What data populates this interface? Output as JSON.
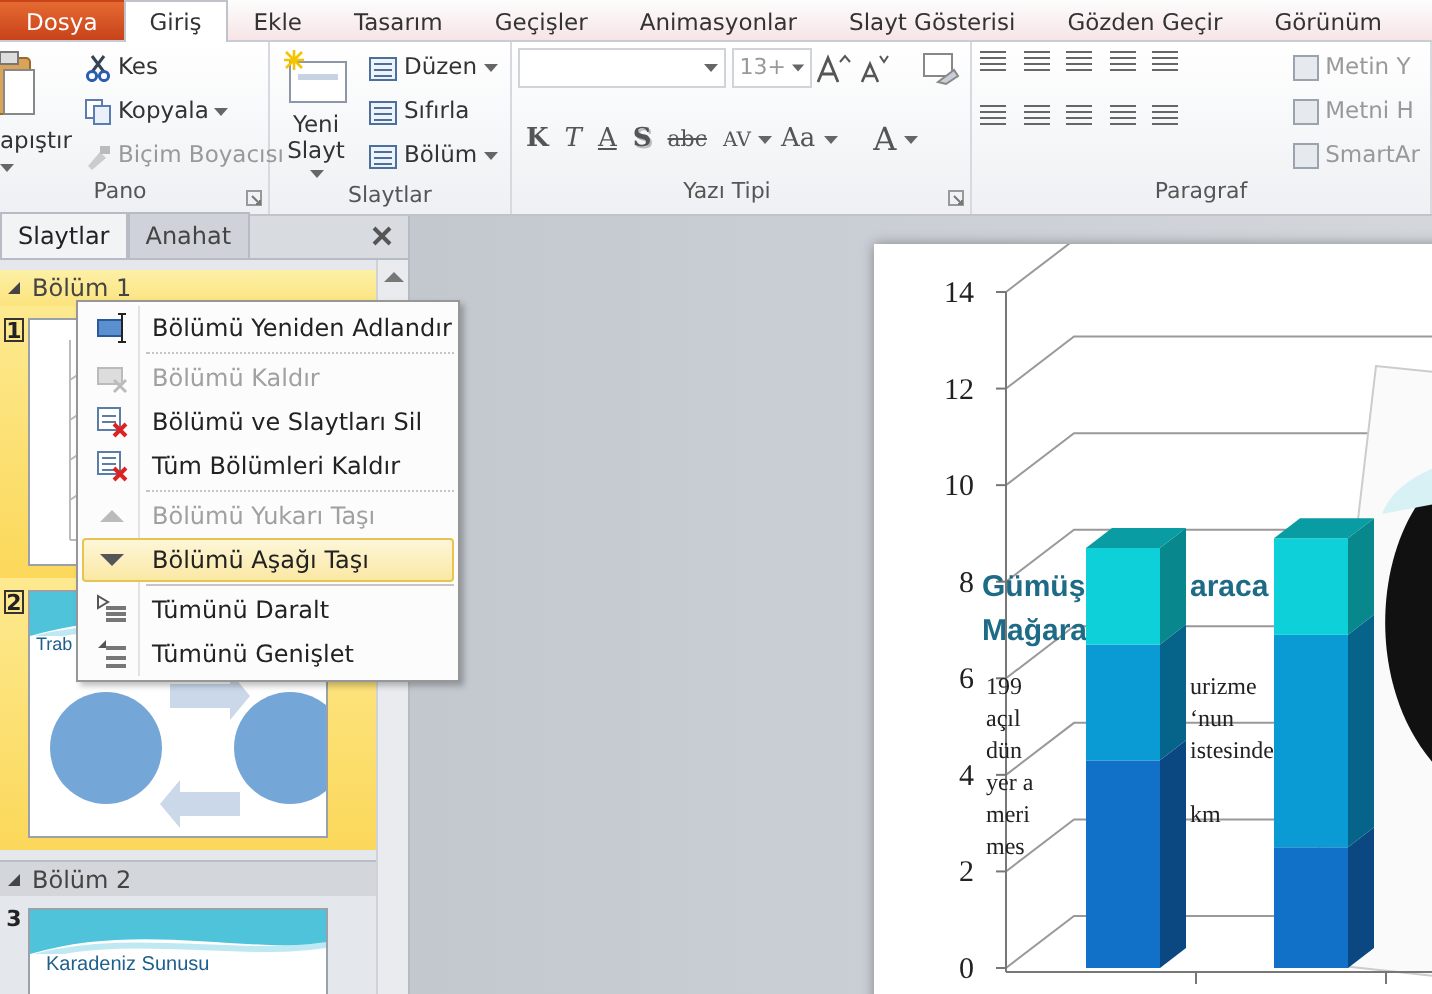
{
  "ribbon_tabs": [
    {
      "label": "Dosya",
      "kind": "file",
      "selected": false
    },
    {
      "label": "Giriş",
      "kind": "tab",
      "selected": true
    },
    {
      "label": "Ekle",
      "kind": "tab",
      "selected": false
    },
    {
      "label": "Tasarım",
      "kind": "tab",
      "selected": false
    },
    {
      "label": "Geçişler",
      "kind": "tab",
      "selected": false
    },
    {
      "label": "Animasyonlar",
      "kind": "tab",
      "selected": false
    },
    {
      "label": "Slayt Gösterisi",
      "kind": "tab",
      "selected": false
    },
    {
      "label": "Gözden Geçir",
      "kind": "tab",
      "selected": false
    },
    {
      "label": "Görünüm",
      "kind": "tab",
      "selected": false
    }
  ],
  "clipboard_group": {
    "title": "Pano",
    "paste": "apıştır",
    "cut": "Kes",
    "copy": "Kopyala",
    "format_painter": {
      "label": "Biçim Boyacısı",
      "disabled": true
    }
  },
  "slides_group": {
    "title": "Slaytlar",
    "new_slide": "Yeni Slayt",
    "layout": "Düzen",
    "reset": "Sıfırla",
    "section": "Bölüm"
  },
  "font_group": {
    "title": "Yazı Tipi",
    "font_size": "13+",
    "format_buttons": [
      "K",
      "T",
      "A",
      "S",
      "abc",
      "AV",
      "Aa",
      "A"
    ]
  },
  "paragraph_group": {
    "title": "Paragraf",
    "text_commands": [
      "Metin Y",
      "Metni H",
      "SmartAr"
    ]
  },
  "pane": {
    "tabs": [
      {
        "label": "Slaytlar",
        "selected": true
      },
      {
        "label": "Anahat",
        "selected": false
      }
    ],
    "sections": [
      {
        "title": "Bölüm 1",
        "selected": true,
        "slides": [
          {
            "number": "1"
          },
          {
            "number": "2",
            "title": "Trab"
          }
        ]
      },
      {
        "title": "Bölüm 2",
        "selected": false,
        "slides": [
          {
            "number": "3",
            "title": "Karadeniz Sunusu"
          }
        ]
      }
    ]
  },
  "context_menu": [
    {
      "kind": "item",
      "label": "Bölümü Yeniden Adlandır",
      "disabled": false,
      "selected": false
    },
    {
      "kind": "separator"
    },
    {
      "kind": "item",
      "label": "Bölümü Kaldır",
      "disabled": true,
      "selected": false
    },
    {
      "kind": "item",
      "label": "Bölümü ve Slaytları Sil",
      "disabled": false,
      "selected": false
    },
    {
      "kind": "item",
      "label": "Tüm Bölümleri Kaldır",
      "disabled": false,
      "selected": false
    },
    {
      "kind": "separator"
    },
    {
      "kind": "item",
      "label": "Bölümü Yukarı Taşı",
      "disabled": true,
      "selected": false
    },
    {
      "kind": "item",
      "label": "Bölümü Aşağı Taşı",
      "disabled": false,
      "selected": true
    },
    {
      "kind": "separator"
    },
    {
      "kind": "item",
      "label": "Tümünü Daralt",
      "disabled": false,
      "selected": false
    },
    {
      "kind": "item",
      "label": "Tümünü Genişlet",
      "disabled": false,
      "selected": false
    }
  ],
  "slide": {
    "title_fragments": [
      "Gümüş",
      "araca",
      "Mağara"
    ],
    "body_fragments": [
      "199",
      "urizme",
      "açıl",
      "‘nun",
      "dün",
      "istesinde",
      "yer a",
      "meri",
      "km",
      "mes"
    ],
    "chart_data": {
      "type": "bar",
      "stacked": true,
      "ylim": [
        0,
        14
      ],
      "yticks": [
        0,
        2,
        4,
        6,
        8,
        10,
        12,
        14
      ],
      "series": [
        {
          "color": "#1170c8",
          "values": [
            4.3,
            2.5
          ]
        },
        {
          "color": "#0a9bd5",
          "values": [
            2.4,
            4.4
          ]
        },
        {
          "color": "#0dd0d8",
          "values": [
            2.0,
            2.0
          ]
        }
      ]
    }
  }
}
